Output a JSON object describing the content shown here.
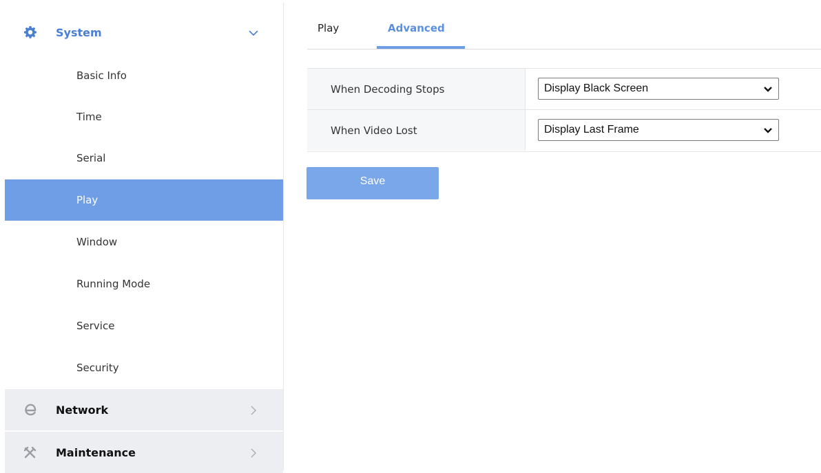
{
  "sidebar": {
    "system": {
      "label": "System",
      "icon": "gear-icon",
      "expanded": true
    },
    "items": [
      {
        "label": "Basic Info",
        "active": false
      },
      {
        "label": "Time",
        "active": false
      },
      {
        "label": "Serial",
        "active": false
      },
      {
        "label": "Play",
        "active": true
      },
      {
        "label": "Window",
        "active": false
      },
      {
        "label": "Running Mode",
        "active": false
      },
      {
        "label": "Service",
        "active": false
      },
      {
        "label": "Security",
        "active": false
      }
    ],
    "network": {
      "label": "Network",
      "icon": "network-e-icon"
    },
    "maintenance": {
      "label": "Maintenance",
      "icon": "tools-icon"
    }
  },
  "tabs": [
    {
      "label": "Play",
      "active": false
    },
    {
      "label": "Advanced",
      "active": true
    }
  ],
  "settings": {
    "rows": [
      {
        "label": "When Decoding Stops",
        "value": "Display Black Screen"
      },
      {
        "label": "When Video Lost",
        "value": "Display Last Frame"
      }
    ]
  },
  "save_label": "Save",
  "colors": {
    "accent": "#6f9ee6",
    "accent_text": "#4a7fd4",
    "save_button": "#7aa7ea",
    "sidebar_gray": "#eceef1"
  }
}
